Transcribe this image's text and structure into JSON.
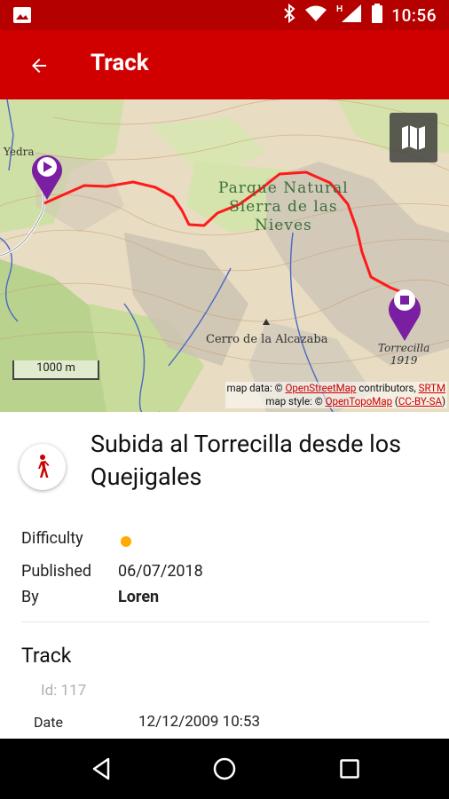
{
  "status": {
    "time": "10:56"
  },
  "appbar": {
    "title": "Track"
  },
  "map": {
    "labels": {
      "park": [
        "Parque Natural",
        "Sierra de las",
        "Nieves"
      ],
      "peak": "Cerro de la Alcazaba",
      "place": "Yedra",
      "end_name": "Torrecilla",
      "end_elev": "1919"
    },
    "scale": "1000 m",
    "attribution": {
      "line1_prefix": "map data: ©",
      "osm": "OpenStreetMap",
      "line1_mid": "contributors,",
      "srtm": "SRTM",
      "line2_prefix": "map style: ©",
      "otm": "OpenTopoMap",
      "license": "CC-BY-SA"
    },
    "colors": {
      "route": "#ff1a1a",
      "marker": "#7b1fa2"
    }
  },
  "route": {
    "title": "Subida al Torrecilla desde los Quejigales",
    "activity_icon": "hiking-icon"
  },
  "details": {
    "difficulty_label": "Difficulty",
    "difficulty_color": "#ffab00",
    "published_label": "Published",
    "published_value": "06/07/2018",
    "by_label": "By",
    "by_value": "Loren"
  },
  "track": {
    "heading": "Track",
    "id_text": "Id: 117",
    "date_label": "Date",
    "date_value": "12/12/2009 10:53"
  }
}
